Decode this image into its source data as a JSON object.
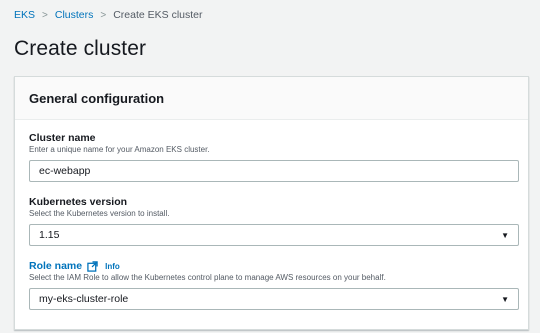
{
  "breadcrumb": {
    "items": [
      "EKS",
      "Clusters",
      "Create EKS cluster"
    ]
  },
  "page": {
    "title": "Create cluster"
  },
  "panel": {
    "title": "General configuration",
    "cluster_name": {
      "label": "Cluster name",
      "description": "Enter a unique name for your Amazon EKS cluster.",
      "value": "ec-webapp"
    },
    "k8s_version": {
      "label": "Kubernetes version",
      "description": "Select the Kubernetes version to install.",
      "value": "1.15"
    },
    "role_name": {
      "label": "Role name",
      "info": "Info",
      "description": "Select the IAM Role to allow the Kubernetes control plane to manage AWS resources on your behalf.",
      "value": "my-eks-cluster-role"
    }
  },
  "icons": {
    "separator": "chevron-right-icon",
    "external_link": "external-link-icon",
    "dropdown": "caret-down-icon"
  },
  "colors": {
    "link": "#0073bb",
    "background": "#f2f3f3",
    "panel_header": "#fafafa",
    "border": "#aab7b8"
  }
}
